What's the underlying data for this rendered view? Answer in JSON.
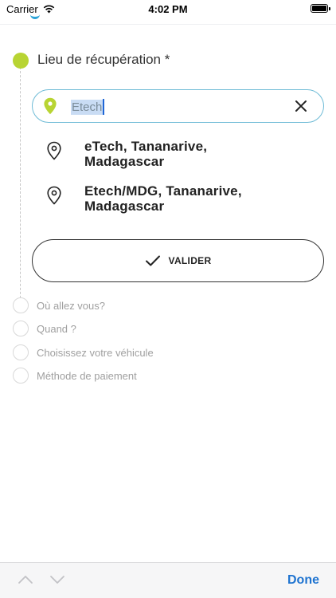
{
  "status_bar": {
    "carrier": "Carrier",
    "time": "4:02 PM"
  },
  "step_current": {
    "title": "Lieu de récupération *",
    "accent_color": "#b8d433"
  },
  "search": {
    "value": "Etech",
    "border_color": "#6ebbd6"
  },
  "suggestions": [
    {
      "line1": "eTech, Tananarive,",
      "line2": "Madagascar"
    },
    {
      "line1": "Etech/MDG, Tananarive,",
      "line2": "Madagascar"
    }
  ],
  "validate_button": {
    "label": "VALIDER"
  },
  "pending_steps": [
    {
      "label": "Où allez vous?"
    },
    {
      "label": "Quand ?"
    },
    {
      "label": "Choisissez votre véhicule"
    },
    {
      "label": "Méthode de paiement"
    }
  ],
  "keyboard_toolbar": {
    "done_label": "Done",
    "done_color": "#1e73d0"
  }
}
